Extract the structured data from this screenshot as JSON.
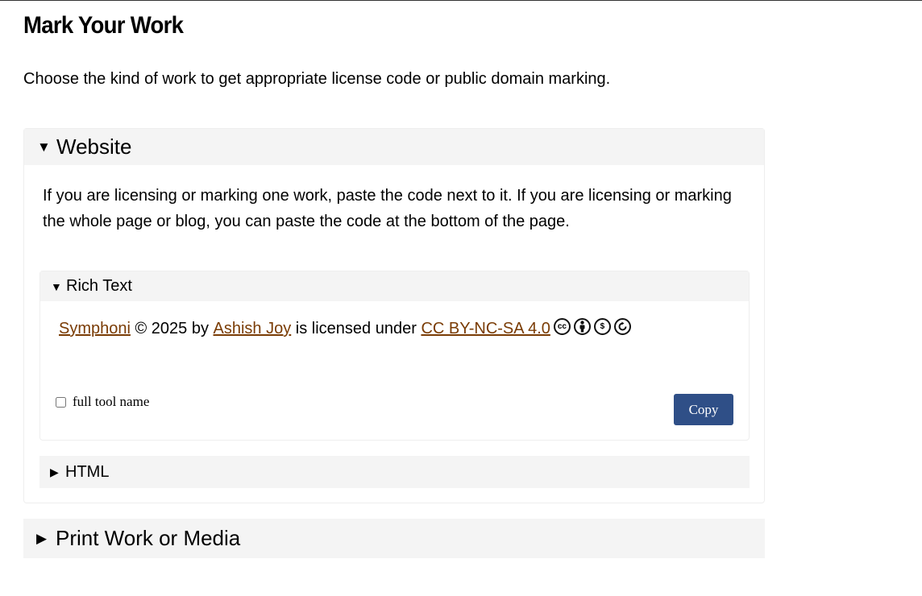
{
  "page": {
    "title": "Mark Your Work",
    "intro": "Choose the kind of work to get appropriate license code or public domain marking."
  },
  "website": {
    "label": "Website",
    "description": "If you are licensing or marking one work, paste the code next to it. If you are licensing or marking the whole page or blog, you can paste the code at the bottom of the page.",
    "rich_text": {
      "label": "Rich Text",
      "work_title": "Symphoni",
      "copyright": " © 2025 by ",
      "author": "Ashish Joy",
      "licensed_under": " is licensed under ",
      "license": "CC BY-NC-SA 4.0",
      "icons": [
        "cc-icon",
        "by-icon",
        "nc-icon",
        "sa-icon"
      ],
      "checkbox_label": "full tool name",
      "copy_label": "Copy"
    },
    "html": {
      "label": "HTML"
    }
  },
  "print": {
    "label": "Print Work or Media"
  },
  "colors": {
    "link": "#7a3c05",
    "button": "#2f4f87",
    "panel_head": "#f4f4f4"
  }
}
